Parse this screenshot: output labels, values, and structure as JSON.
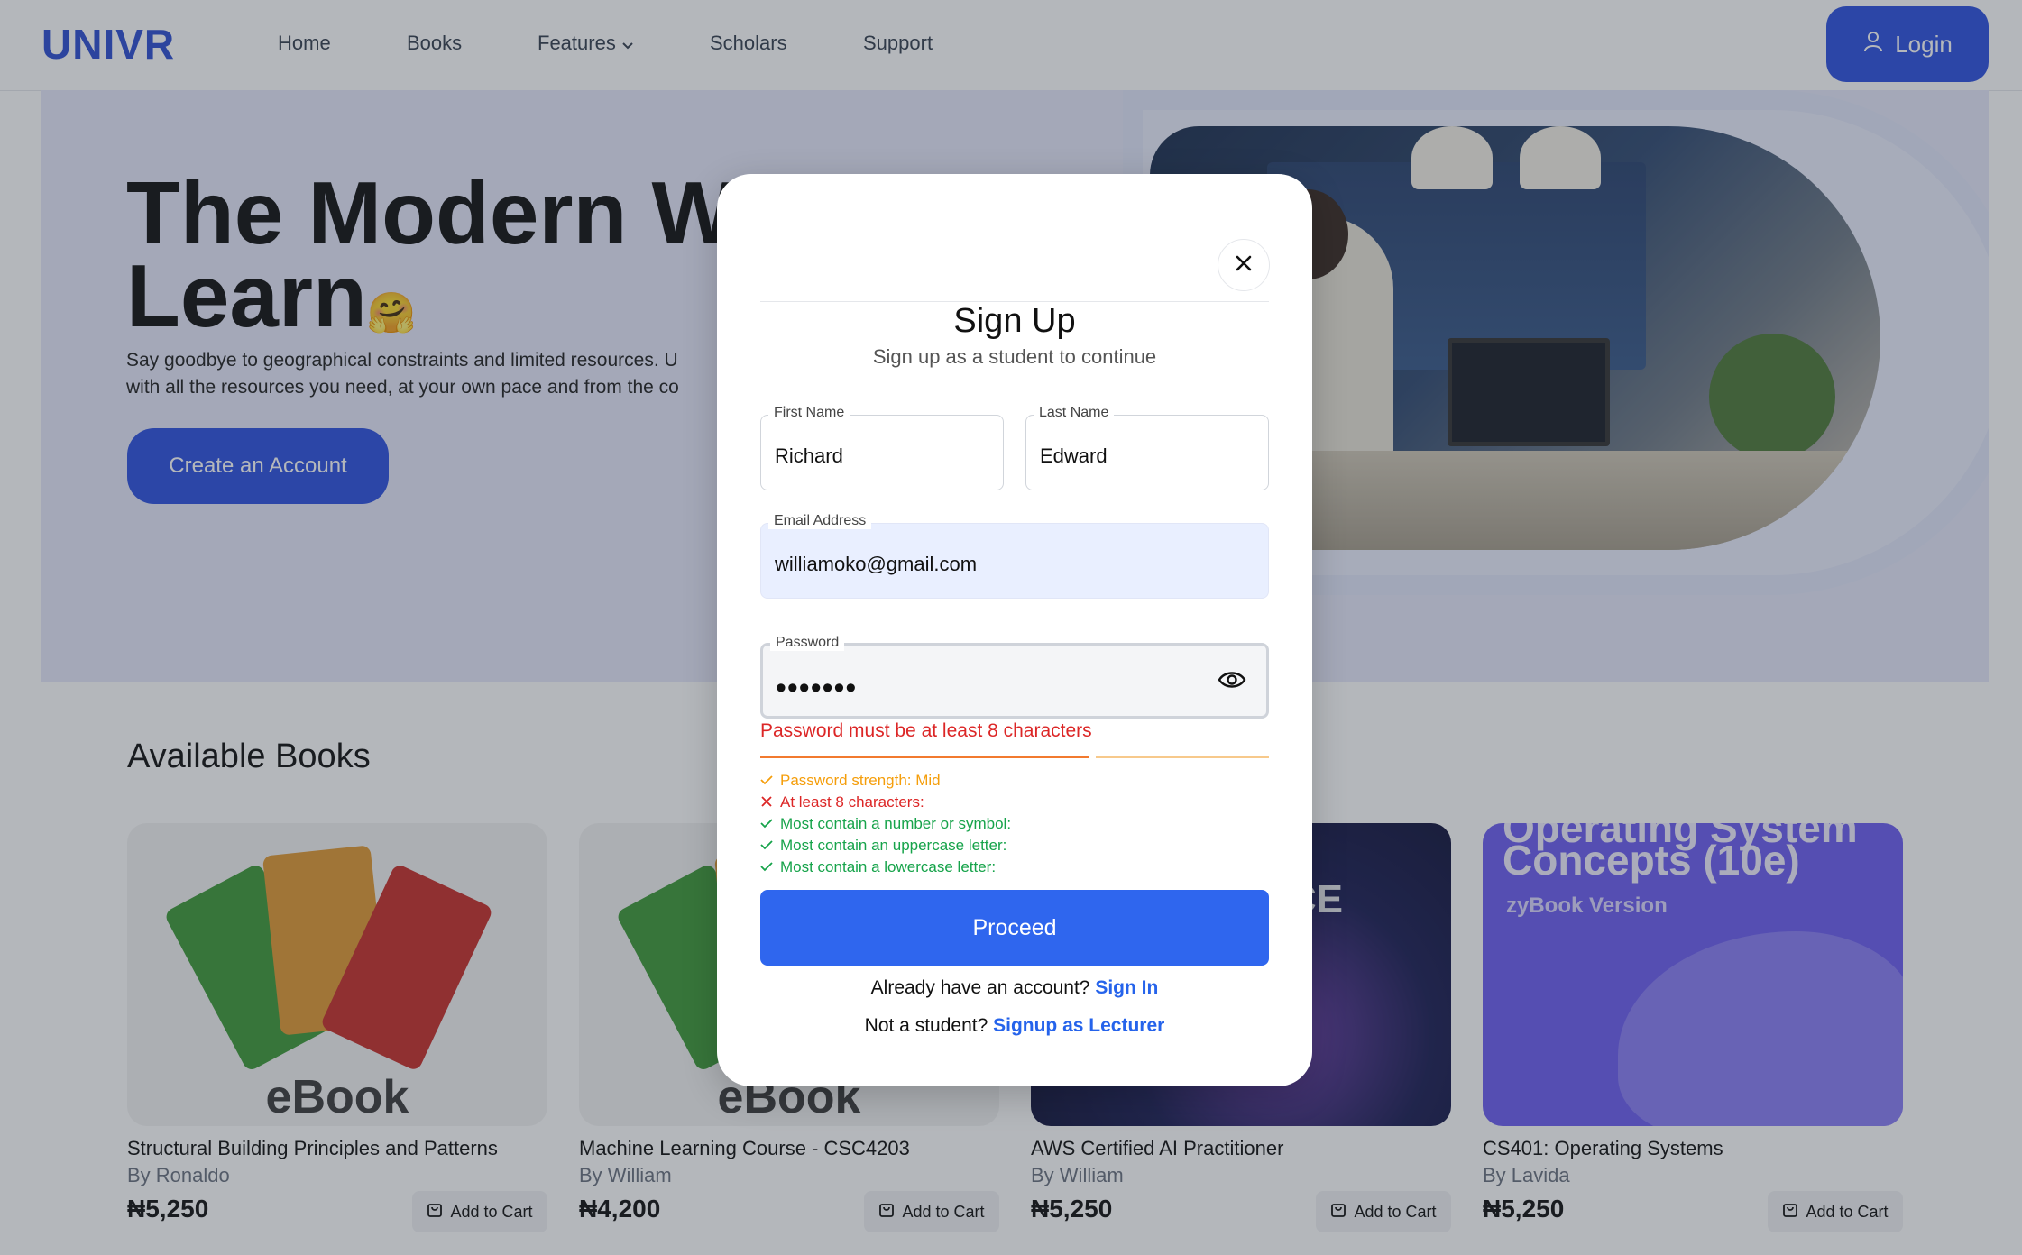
{
  "nav": {
    "logo": "UNIVR",
    "links": [
      "Home",
      "Books",
      "Features",
      "Scholars",
      "Support"
    ],
    "login_label": "Login"
  },
  "hero": {
    "title_line1": "The Modern Wa",
    "title_line2": "Learn",
    "emoji": "🤗",
    "desc_line1": "Say goodbye to geographical constraints and limited resources. U",
    "desc_line2": "with all the resources you need, at your own pace and from the co",
    "create_label": "Create an Account"
  },
  "books_section": {
    "title": "Available Books",
    "books": [
      {
        "title": "Structural Building Principles and Patterns",
        "author": "By Ronaldo",
        "price": "₦5,250",
        "cart": "Add to Cart",
        "cover_text": "eBook"
      },
      {
        "title": "Machine Learning Course - CSC4203",
        "author": "By William",
        "price": "₦4,200",
        "cart": "Add to Cart",
        "cover_text": "eBook"
      },
      {
        "title": "AWS Certified AI Practitioner",
        "author": "By William",
        "price": "₦5,250",
        "cart": "Add to Cart",
        "cover_text": "CE"
      },
      {
        "title": "CS401: Operating Systems",
        "author": "By Lavida",
        "price": "₦5,250",
        "cart": "Add to Cart",
        "cover_text": "Concepts (10e)",
        "cover_top": "Operating System",
        "cover_sub": "zyBook Version"
      }
    ]
  },
  "modal": {
    "title": "Sign Up",
    "subtitle": "Sign up as a student to continue",
    "first_name": {
      "label": "First Name",
      "value": "Richard"
    },
    "last_name": {
      "label": "Last Name",
      "value": "Edward"
    },
    "email": {
      "label": "Email Address",
      "value": "williamoko@gmail.com"
    },
    "password": {
      "label": "Password",
      "value": "•••••••"
    },
    "error": "Password must be at least 8 characters",
    "strength_label": "Password strength: Mid",
    "rules": [
      {
        "text": "At least 8 characters:",
        "status": "bad"
      },
      {
        "text": "Most contain a number or symbol:",
        "status": "ok"
      },
      {
        "text": "Most contain an uppercase letter:",
        "status": "ok"
      },
      {
        "text": "Most contain a lowercase letter:",
        "status": "ok"
      }
    ],
    "proceed_label": "Proceed",
    "have_account": "Already have an account?",
    "sign_in": "Sign In",
    "not_student": "Not a student?",
    "signup_lecturer": "Signup as Lecturer"
  },
  "colors": {
    "brand": "#2f52e0",
    "proceed": "#2f66ee",
    "error": "#dc2626",
    "success": "#16a34a",
    "warning": "#f59e0b"
  }
}
